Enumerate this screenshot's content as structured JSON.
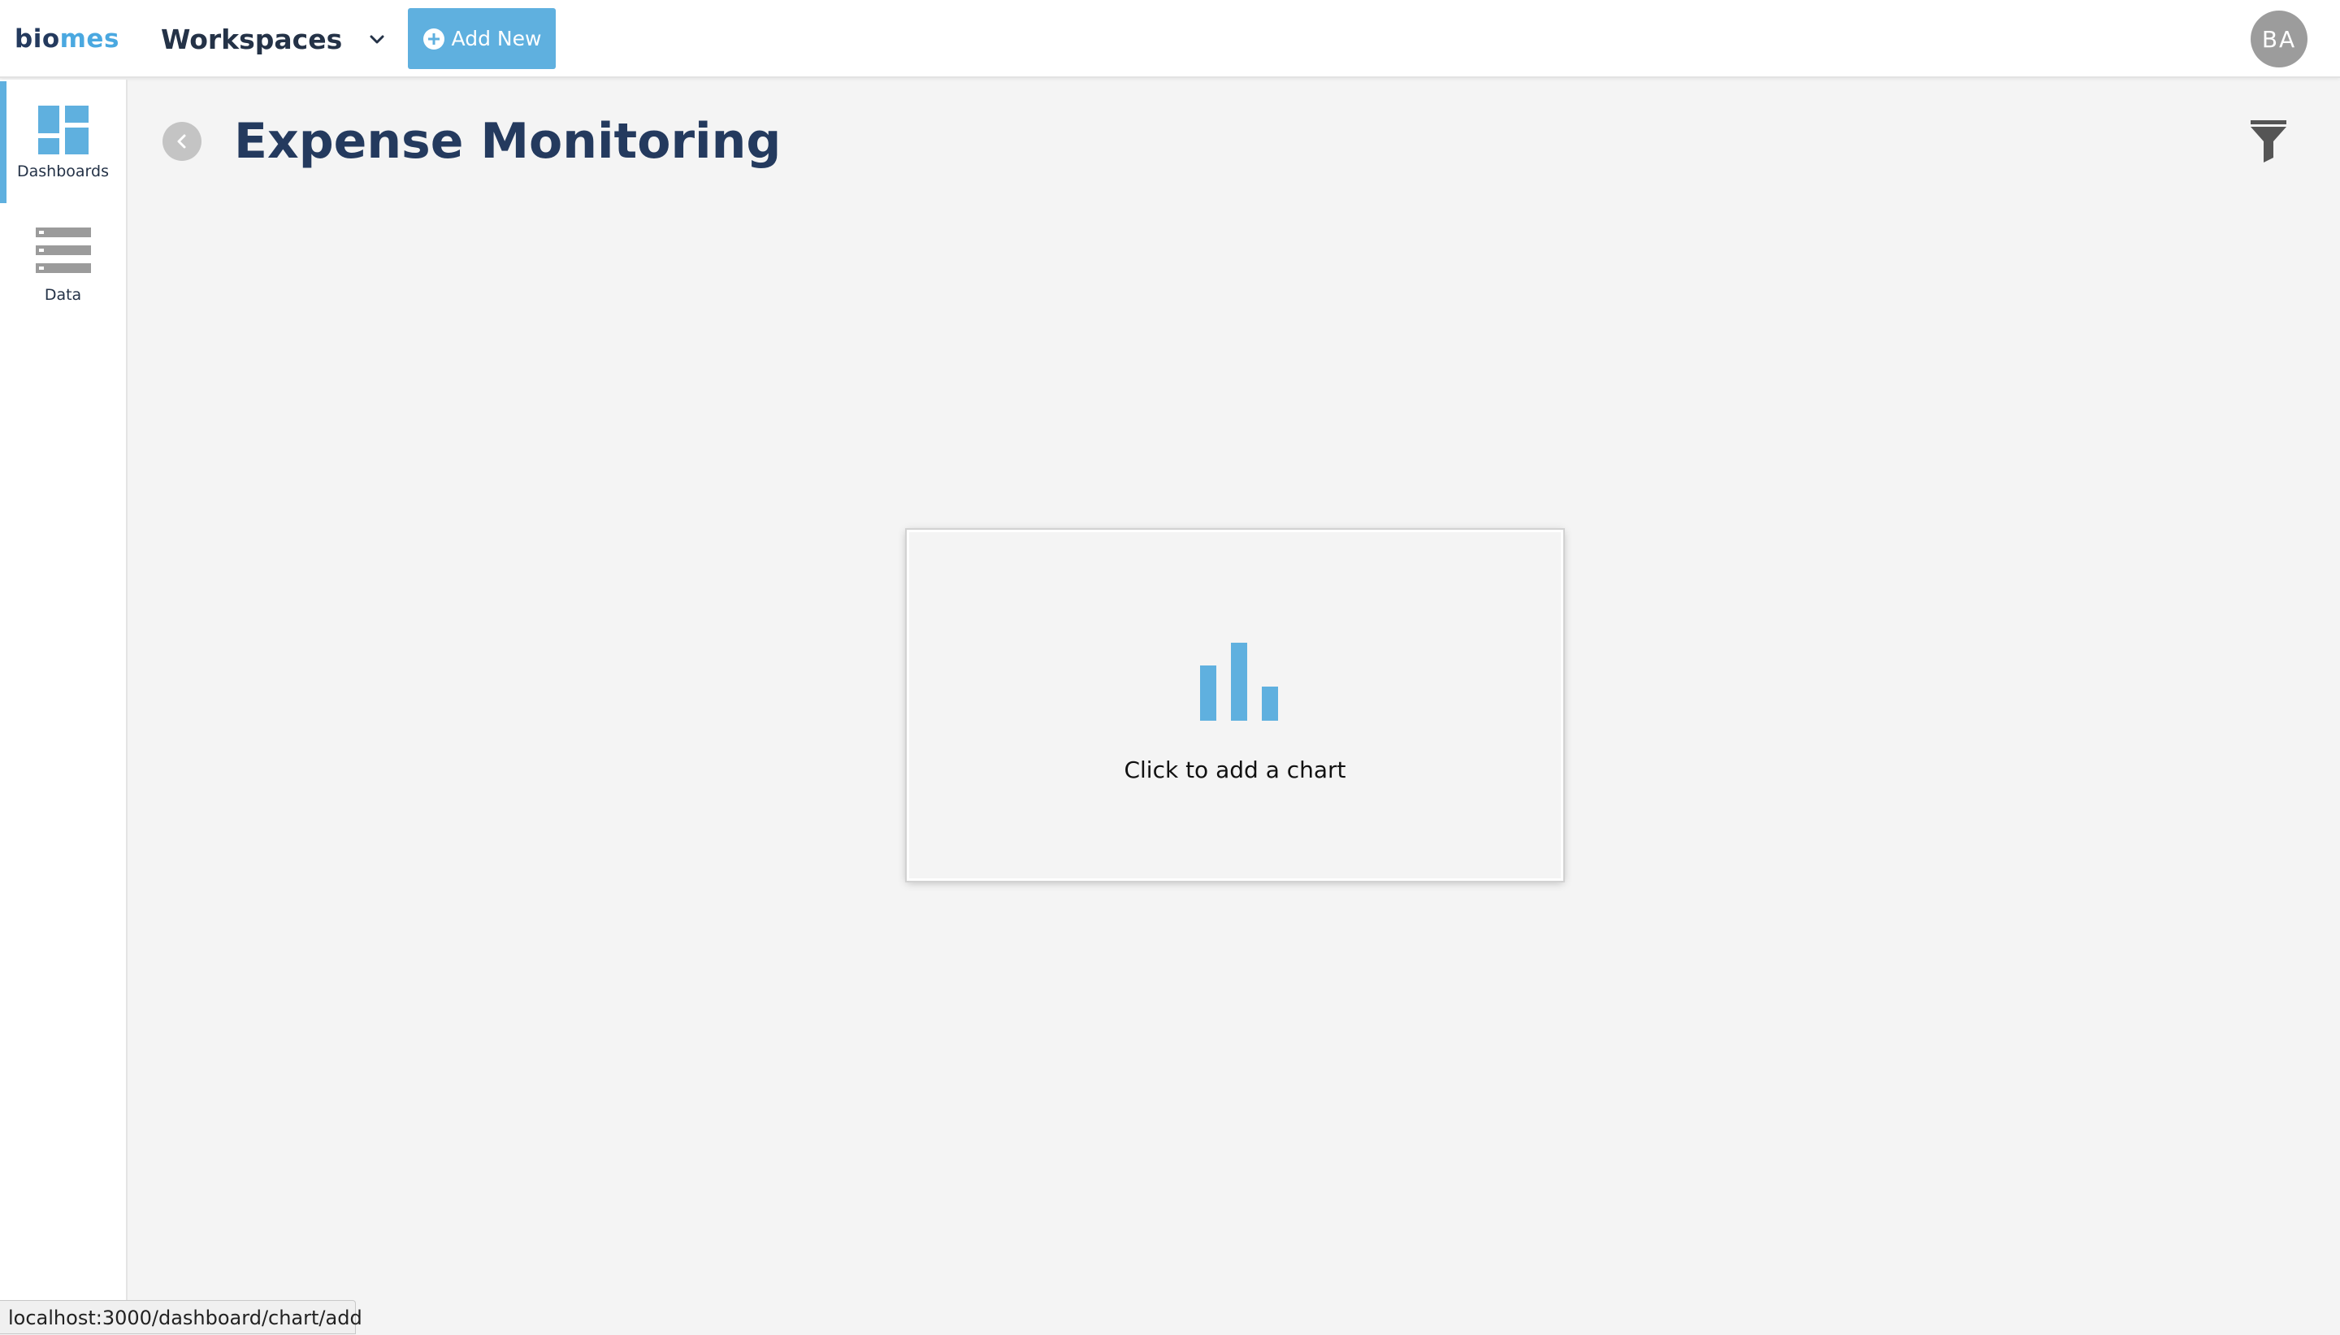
{
  "header": {
    "logo_part1": "bio",
    "logo_part2": "mes",
    "workspaces_label": "Workspaces",
    "add_new_label": "Add New",
    "avatar_initials": "BA"
  },
  "sidebar": {
    "items": [
      {
        "label": "Dashboards",
        "icon": "dashboard-grid-icon",
        "active": true
      },
      {
        "label": "Data",
        "icon": "data-list-icon",
        "active": false
      }
    ]
  },
  "main": {
    "title": "Expense Monitoring",
    "empty_chart_text": "Click to add a chart"
  },
  "status_bar": {
    "url": "localhost:3000/dashboard/chart/add"
  },
  "colors": {
    "accent": "#5fb0df",
    "title": "#243a5e",
    "avatar_bg": "#9c9c9c",
    "icon_gray": "#9b9b9b"
  }
}
